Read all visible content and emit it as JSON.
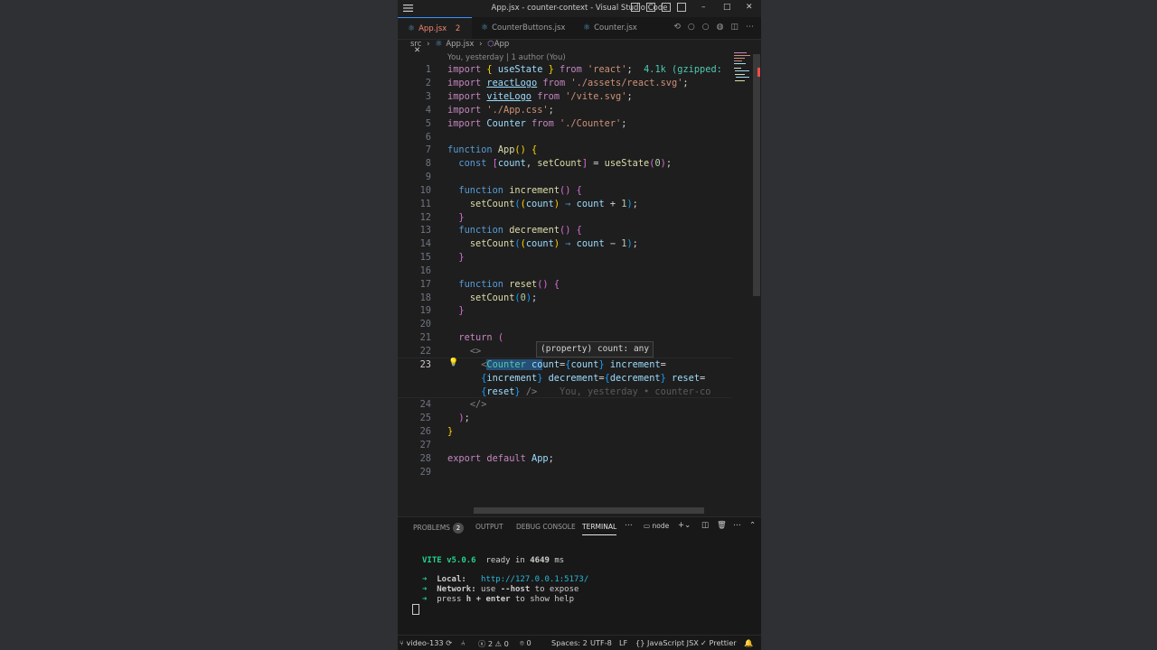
{
  "window": {
    "title": "App.jsx - counter-context - Visual Studio Code"
  },
  "tabs": [
    {
      "label": "App.jsx",
      "badge": "2"
    },
    {
      "label": "CounterButtons.jsx"
    },
    {
      "label": "Counter.jsx"
    }
  ],
  "breadcrumb": {
    "folder": "src",
    "file": "App.jsx",
    "symbol": "App"
  },
  "blame": "You, yesterday | 1 author (You)",
  "editor": {
    "line_numbers": [
      "1",
      "2",
      "3",
      "4",
      "5",
      "6",
      "7",
      "8",
      "9",
      "10",
      "11",
      "12",
      "13",
      "14",
      "15",
      "16",
      "17",
      "18",
      "19",
      "20",
      "21",
      "22",
      "23",
      "24",
      "25",
      "26",
      "27",
      "28",
      "29"
    ],
    "import_cost": "4.1k (gzipped:",
    "hover": "(property) count: any",
    "inline_blame": "You, yesterday • counter-co"
  },
  "panel": {
    "tabs": {
      "problems": "PROBLEMS",
      "problems_count": "2",
      "output": "OUTPUT",
      "debug": "DEBUG CONSOLE",
      "terminal": "TERMINAL"
    },
    "terminal_name": "node",
    "terminal": {
      "vite": "VITE v5.0.6",
      "ready": "ready in",
      "ready_ms": "4649",
      "ms": "ms",
      "local_label": "Local:",
      "local_url": "http://127.0.0.1:5173/",
      "network_label": "Network:",
      "network_text": "use",
      "network_flag": "--host",
      "network_tail": "to expose",
      "help_pre": "press",
      "help_h": "h + enter",
      "help_tail": "to show help"
    }
  },
  "status": {
    "branch": "video-133",
    "errors": "2",
    "warnings": "0",
    "ports": "0",
    "spaces": "Spaces: 2",
    "encoding": "UTF-8",
    "eol": "LF",
    "language": "JavaScript JSX",
    "formatter": "Prettier"
  },
  "colors": {
    "accent": "#3794ff",
    "editor_bg": "#1e1e1e",
    "keyword": "#c586c0",
    "function": "#dcdcaa",
    "string": "#ce9178",
    "variable": "#9cdcfe",
    "tag": "#4ec9b0"
  }
}
